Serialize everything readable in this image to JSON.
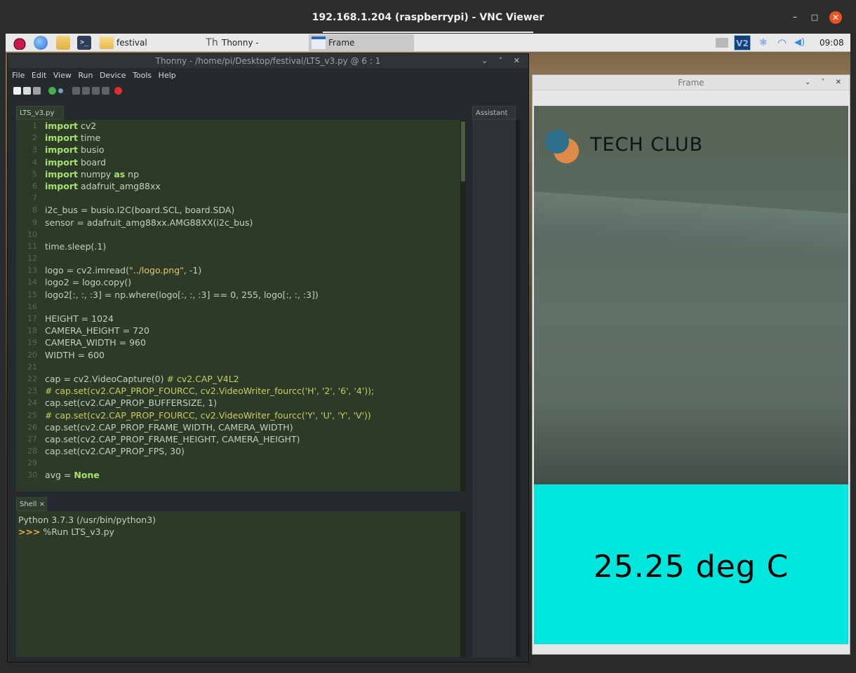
{
  "vnc": {
    "title": "192.168.1.204 (raspberrypi) - VNC Viewer",
    "minimize_glyph": "–",
    "maximize_glyph": "□",
    "close_glyph": "✕"
  },
  "taskbar": {
    "icons": [
      "raspberry-pi-menu-icon",
      "web-browser-icon",
      "file-manager-icon",
      "terminal-icon"
    ],
    "terminal_glyph": ">_",
    "tasks": [
      {
        "label": "festival",
        "icon": "folder-icon"
      },
      {
        "label": "Thonny  -  /home/pi/...",
        "icon": "thonny-icon"
      },
      {
        "label": "Frame",
        "icon": "window-icon"
      }
    ],
    "tray": {
      "vnc_label": "V2",
      "clock": "09:08"
    }
  },
  "thonny": {
    "title": "Thonny  -  /home/pi/Desktop/festival/LTS_v3.py  @  6 : 1",
    "controls": "⌄ ˄ ✕",
    "menu": [
      "File",
      "Edit",
      "View",
      "Run",
      "Device",
      "Tools",
      "Help"
    ],
    "editor_tab": "LTS_v3.py ×",
    "assistant_tab": "Assistant ×",
    "shell_tab": "Shell ×",
    "code_lines": [
      {
        "n": "1",
        "html": "<span class='kw'>import</span> cv2"
      },
      {
        "n": "2",
        "html": "<span class='kw'>import</span> time"
      },
      {
        "n": "3",
        "html": "<span class='kw'>import</span> busio"
      },
      {
        "n": "4",
        "html": "<span class='kw'>import</span> board"
      },
      {
        "n": "5",
        "html": "<span class='kw'>import</span> numpy <span class='kw'>as</span> np"
      },
      {
        "n": "6",
        "html": "<span class='kw'>import</span> adafruit_amg88xx"
      },
      {
        "n": "7",
        "html": ""
      },
      {
        "n": "8",
        "html": "i2c_bus = busio.I2C(board.SCL, board.SDA)"
      },
      {
        "n": "9",
        "html": "sensor = adafruit_amg88xx.AMG88XX(i2c_bus)"
      },
      {
        "n": "10",
        "html": ""
      },
      {
        "n": "11",
        "html": "time.sleep(.1)"
      },
      {
        "n": "12",
        "html": ""
      },
      {
        "n": "13",
        "html": "logo = cv2.imread(<span class='str'>\"../logo.png\"</span>, -1)"
      },
      {
        "n": "14",
        "html": "logo2 = logo.copy()"
      },
      {
        "n": "15",
        "html": "logo2[:, :, :3] = np.where(logo[:, :, :3] == 0, 255, logo[:, :, :3])"
      },
      {
        "n": "16",
        "html": ""
      },
      {
        "n": "17",
        "html": "HEIGHT = 1024"
      },
      {
        "n": "18",
        "html": "CAMERA_HEIGHT = 720"
      },
      {
        "n": "19",
        "html": "CAMERA_WIDTH = 960"
      },
      {
        "n": "20",
        "html": "WIDTH = 600"
      },
      {
        "n": "21",
        "html": ""
      },
      {
        "n": "22",
        "html": "cap = cv2.VideoCapture(0) <span class='cmt'># cv2.CAP_V4L2</span>"
      },
      {
        "n": "23",
        "html": "<span class='cmt'># cap.set(cv2.CAP_PROP_FOURCC, cv2.VideoWriter_fourcc('H', '2', '6', '4'));</span>"
      },
      {
        "n": "24",
        "html": "cap.set(cv2.CAP_PROP_BUFFERSIZE, 1)"
      },
      {
        "n": "25",
        "html": "<span class='cmt'># cap.set(cv2.CAP_PROP_FOURCC, cv2.VideoWriter_fourcc('Y', 'U', 'Y', 'V'))</span>"
      },
      {
        "n": "26",
        "html": "cap.set(cv2.CAP_PROP_FRAME_WIDTH, CAMERA_WIDTH)"
      },
      {
        "n": "27",
        "html": "cap.set(cv2.CAP_PROP_FRAME_HEIGHT, CAMERA_HEIGHT)"
      },
      {
        "n": "28",
        "html": "cap.set(cv2.CAP_PROP_FPS, 30)"
      },
      {
        "n": "29",
        "html": ""
      },
      {
        "n": "30",
        "html": "avg = <span class='kw'>None</span>"
      }
    ],
    "shell_lines": [
      {
        "html": "Python 3.7.3 (/usr/bin/python3)"
      },
      {
        "html": "<span class='prompt'>&gt;&gt;&gt;</span> %Run LTS_v3.py"
      }
    ]
  },
  "frame_window": {
    "title": "Frame",
    "controls": "⌄ ˄ ✕",
    "logo_text": "TECH CLUB",
    "temperature_text": "25.25 deg C",
    "colors": {
      "cyan_panel": "#00e5dc",
      "logo_blue": "#2f6f8c",
      "logo_orange": "#e08a4a"
    }
  }
}
